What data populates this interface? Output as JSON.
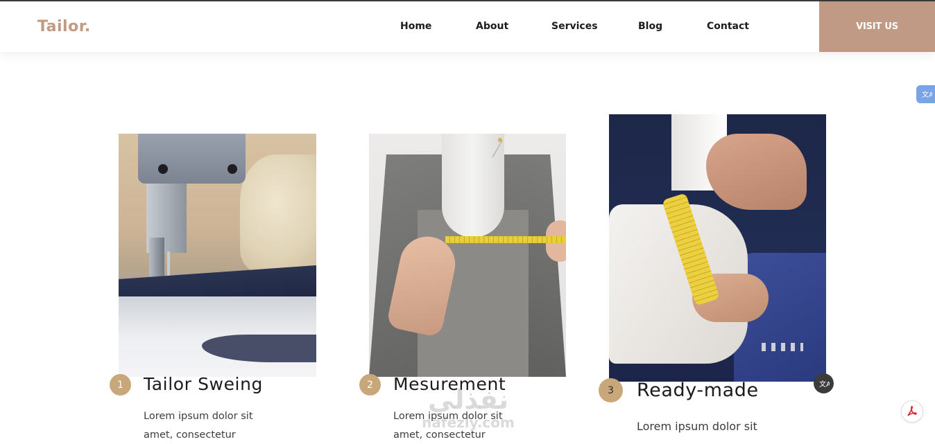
{
  "navbar": {
    "logo": "Tailor.",
    "links": [
      "Home",
      "About",
      "Services",
      "Blog",
      "Contact"
    ],
    "cta_label": "VISIT US",
    "accent_color": "#c09a85"
  },
  "cards": [
    {
      "number": "1",
      "title": "Tailor Sweing",
      "text_line1": "Lorem ipsum dolor sit",
      "text_line2": "amet, consectetur",
      "image": "sewing-machine"
    },
    {
      "number": "2",
      "title": "Mesurement",
      "text_line1": "Lorem ipsum dolor sit",
      "text_line2": "amet, consectetur",
      "image": "mannequin-measuring-tape"
    },
    {
      "number": "3",
      "title": "Ready-made",
      "text_line1": "Lorem ipsum dolor sit",
      "image": "cuff-measuring-tape"
    }
  ],
  "overlays": {
    "translate_icon": "translate-icon",
    "pdf_icon": "pdf-icon"
  },
  "watermark": {
    "arabic": "نفذلي",
    "latin": "nafezly.com"
  }
}
